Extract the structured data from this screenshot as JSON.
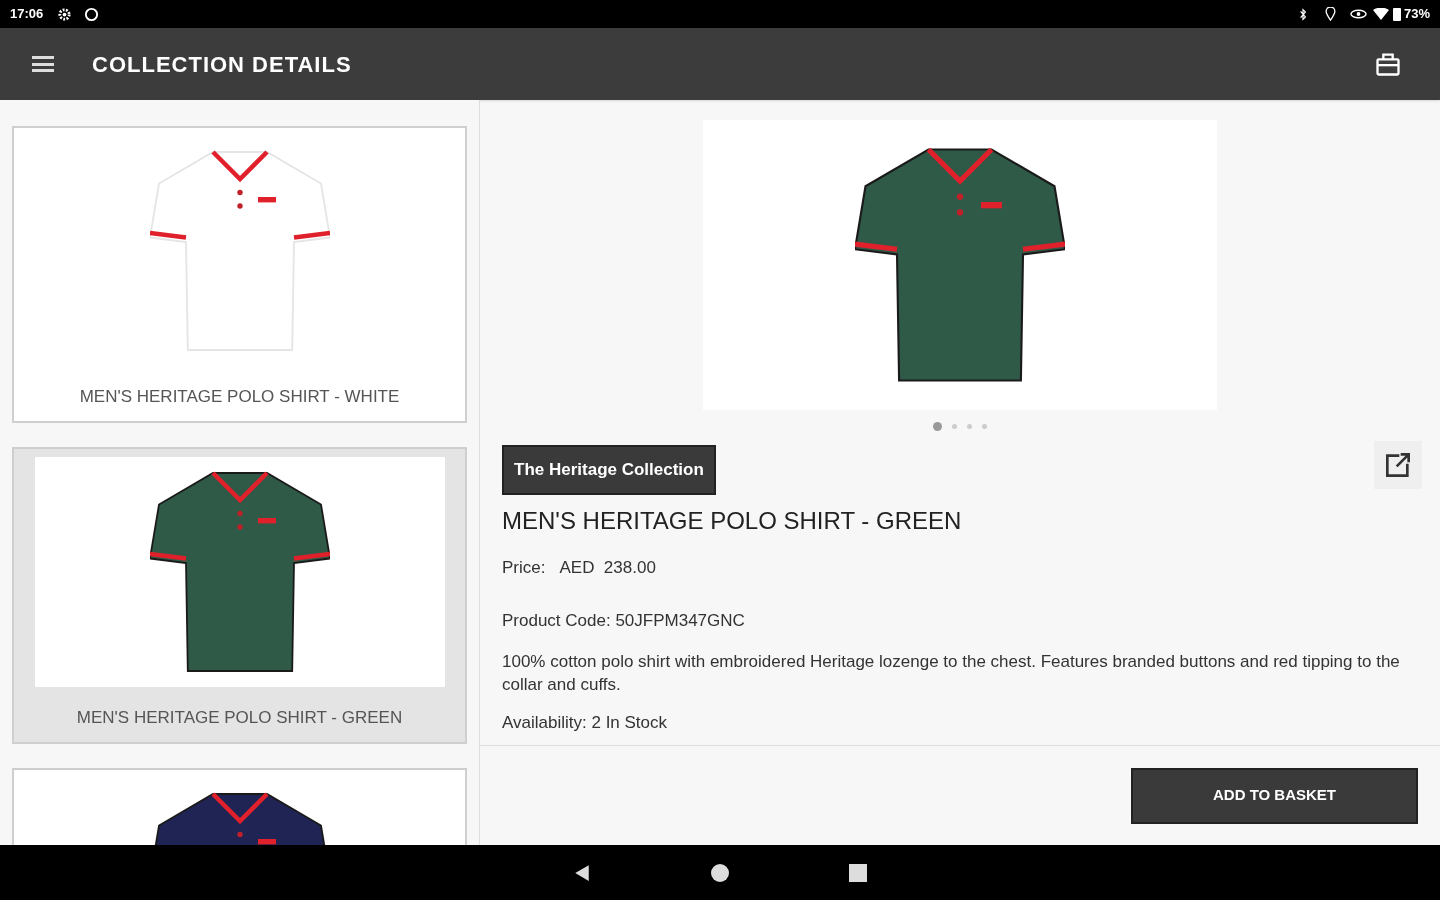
{
  "status_bar": {
    "time": "17:06",
    "battery": "73%"
  },
  "app_bar": {
    "title": "COLLECTION DETAILS"
  },
  "products": [
    {
      "name": "MEN'S HERITAGE POLO SHIRT - WHITE",
      "color": "#ffffff",
      "selected": false
    },
    {
      "name": "MEN'S HERITAGE POLO SHIRT - GREEN",
      "color": "#2f5a47",
      "selected": true
    },
    {
      "color": "#1f2454",
      "selected": false
    }
  ],
  "detail": {
    "carousel": [
      {
        "selected": true
      },
      {
        "selected": false
      },
      {
        "selected": false
      },
      {
        "selected": false
      }
    ],
    "collection_tag": "The Heritage Collection",
    "title": "MEN'S HERITAGE POLO SHIRT - GREEN",
    "price_label": "Price:",
    "price": "AED  238.00",
    "product_code": "Product Code: 50JFPM347GNC",
    "description": "100% cotton polo shirt with embroidered Heritage lozenge to the chest. Features branded buttons and red tipping to the collar and cuffs.",
    "availability": "Availability: 2 In Stock",
    "add_button": "ADD TO BASKET"
  }
}
